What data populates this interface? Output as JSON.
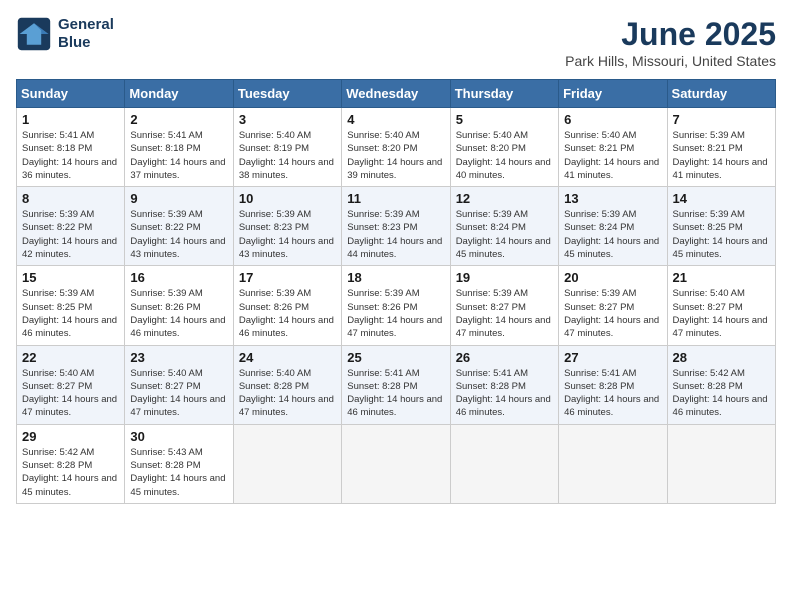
{
  "header": {
    "logo_line1": "General",
    "logo_line2": "Blue",
    "month": "June 2025",
    "location": "Park Hills, Missouri, United States"
  },
  "weekdays": [
    "Sunday",
    "Monday",
    "Tuesday",
    "Wednesday",
    "Thursday",
    "Friday",
    "Saturday"
  ],
  "weeks": [
    [
      {
        "day": "1",
        "sunrise": "Sunrise: 5:41 AM",
        "sunset": "Sunset: 8:18 PM",
        "daylight": "Daylight: 14 hours and 36 minutes."
      },
      {
        "day": "2",
        "sunrise": "Sunrise: 5:41 AM",
        "sunset": "Sunset: 8:18 PM",
        "daylight": "Daylight: 14 hours and 37 minutes."
      },
      {
        "day": "3",
        "sunrise": "Sunrise: 5:40 AM",
        "sunset": "Sunset: 8:19 PM",
        "daylight": "Daylight: 14 hours and 38 minutes."
      },
      {
        "day": "4",
        "sunrise": "Sunrise: 5:40 AM",
        "sunset": "Sunset: 8:20 PM",
        "daylight": "Daylight: 14 hours and 39 minutes."
      },
      {
        "day": "5",
        "sunrise": "Sunrise: 5:40 AM",
        "sunset": "Sunset: 8:20 PM",
        "daylight": "Daylight: 14 hours and 40 minutes."
      },
      {
        "day": "6",
        "sunrise": "Sunrise: 5:40 AM",
        "sunset": "Sunset: 8:21 PM",
        "daylight": "Daylight: 14 hours and 41 minutes."
      },
      {
        "day": "7",
        "sunrise": "Sunrise: 5:39 AM",
        "sunset": "Sunset: 8:21 PM",
        "daylight": "Daylight: 14 hours and 41 minutes."
      }
    ],
    [
      {
        "day": "8",
        "sunrise": "Sunrise: 5:39 AM",
        "sunset": "Sunset: 8:22 PM",
        "daylight": "Daylight: 14 hours and 42 minutes."
      },
      {
        "day": "9",
        "sunrise": "Sunrise: 5:39 AM",
        "sunset": "Sunset: 8:22 PM",
        "daylight": "Daylight: 14 hours and 43 minutes."
      },
      {
        "day": "10",
        "sunrise": "Sunrise: 5:39 AM",
        "sunset": "Sunset: 8:23 PM",
        "daylight": "Daylight: 14 hours and 43 minutes."
      },
      {
        "day": "11",
        "sunrise": "Sunrise: 5:39 AM",
        "sunset": "Sunset: 8:23 PM",
        "daylight": "Daylight: 14 hours and 44 minutes."
      },
      {
        "day": "12",
        "sunrise": "Sunrise: 5:39 AM",
        "sunset": "Sunset: 8:24 PM",
        "daylight": "Daylight: 14 hours and 45 minutes."
      },
      {
        "day": "13",
        "sunrise": "Sunrise: 5:39 AM",
        "sunset": "Sunset: 8:24 PM",
        "daylight": "Daylight: 14 hours and 45 minutes."
      },
      {
        "day": "14",
        "sunrise": "Sunrise: 5:39 AM",
        "sunset": "Sunset: 8:25 PM",
        "daylight": "Daylight: 14 hours and 45 minutes."
      }
    ],
    [
      {
        "day": "15",
        "sunrise": "Sunrise: 5:39 AM",
        "sunset": "Sunset: 8:25 PM",
        "daylight": "Daylight: 14 hours and 46 minutes."
      },
      {
        "day": "16",
        "sunrise": "Sunrise: 5:39 AM",
        "sunset": "Sunset: 8:26 PM",
        "daylight": "Daylight: 14 hours and 46 minutes."
      },
      {
        "day": "17",
        "sunrise": "Sunrise: 5:39 AM",
        "sunset": "Sunset: 8:26 PM",
        "daylight": "Daylight: 14 hours and 46 minutes."
      },
      {
        "day": "18",
        "sunrise": "Sunrise: 5:39 AM",
        "sunset": "Sunset: 8:26 PM",
        "daylight": "Daylight: 14 hours and 47 minutes."
      },
      {
        "day": "19",
        "sunrise": "Sunrise: 5:39 AM",
        "sunset": "Sunset: 8:27 PM",
        "daylight": "Daylight: 14 hours and 47 minutes."
      },
      {
        "day": "20",
        "sunrise": "Sunrise: 5:39 AM",
        "sunset": "Sunset: 8:27 PM",
        "daylight": "Daylight: 14 hours and 47 minutes."
      },
      {
        "day": "21",
        "sunrise": "Sunrise: 5:40 AM",
        "sunset": "Sunset: 8:27 PM",
        "daylight": "Daylight: 14 hours and 47 minutes."
      }
    ],
    [
      {
        "day": "22",
        "sunrise": "Sunrise: 5:40 AM",
        "sunset": "Sunset: 8:27 PM",
        "daylight": "Daylight: 14 hours and 47 minutes."
      },
      {
        "day": "23",
        "sunrise": "Sunrise: 5:40 AM",
        "sunset": "Sunset: 8:27 PM",
        "daylight": "Daylight: 14 hours and 47 minutes."
      },
      {
        "day": "24",
        "sunrise": "Sunrise: 5:40 AM",
        "sunset": "Sunset: 8:28 PM",
        "daylight": "Daylight: 14 hours and 47 minutes."
      },
      {
        "day": "25",
        "sunrise": "Sunrise: 5:41 AM",
        "sunset": "Sunset: 8:28 PM",
        "daylight": "Daylight: 14 hours and 46 minutes."
      },
      {
        "day": "26",
        "sunrise": "Sunrise: 5:41 AM",
        "sunset": "Sunset: 8:28 PM",
        "daylight": "Daylight: 14 hours and 46 minutes."
      },
      {
        "day": "27",
        "sunrise": "Sunrise: 5:41 AM",
        "sunset": "Sunset: 8:28 PM",
        "daylight": "Daylight: 14 hours and 46 minutes."
      },
      {
        "day": "28",
        "sunrise": "Sunrise: 5:42 AM",
        "sunset": "Sunset: 8:28 PM",
        "daylight": "Daylight: 14 hours and 46 minutes."
      }
    ],
    [
      {
        "day": "29",
        "sunrise": "Sunrise: 5:42 AM",
        "sunset": "Sunset: 8:28 PM",
        "daylight": "Daylight: 14 hours and 45 minutes."
      },
      {
        "day": "30",
        "sunrise": "Sunrise: 5:43 AM",
        "sunset": "Sunset: 8:28 PM",
        "daylight": "Daylight: 14 hours and 45 minutes."
      },
      null,
      null,
      null,
      null,
      null
    ]
  ]
}
